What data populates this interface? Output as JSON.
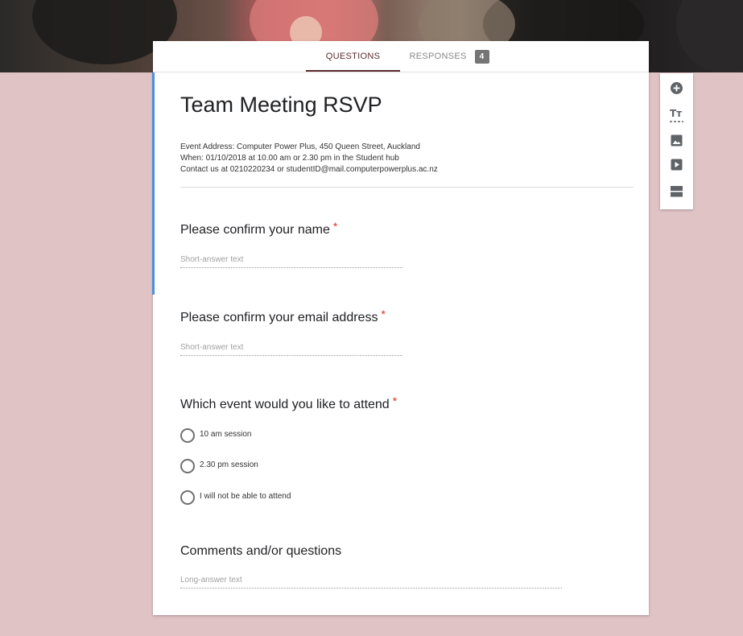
{
  "tabs": {
    "questions": "QUESTIONS",
    "responses": "RESPONSES",
    "responses_count": "4"
  },
  "form": {
    "title": "Team Meeting RSVP",
    "description_lines": [
      "Event Address: Computer Power Plus, 450 Queen Street, Auckland",
      "When: 01/10/2018 at 10.00 am or 2.30 pm in the Student hub",
      "Contact us at 0210220234 or studentID@mail.computerpowerplus.ac.nz"
    ]
  },
  "questions": [
    {
      "title": "Please confirm your name",
      "required_mark": "*",
      "placeholder": "Short-answer text"
    },
    {
      "title": "Please confirm your email address",
      "required_mark": "*",
      "placeholder": "Short-answer text"
    },
    {
      "title": "Which event would you like to attend",
      "required_mark": "*",
      "options": [
        "10 am session",
        "2.30 pm session",
        "I will not be able to attend"
      ]
    },
    {
      "title": "Comments and/or questions",
      "placeholder": "Long-answer text"
    }
  ],
  "toolbar": {
    "icons": [
      "add-question-icon",
      "add-title-icon",
      "add-image-icon",
      "add-video-icon",
      "add-section-icon"
    ]
  },
  "colors": {
    "background": "#dfc3c5",
    "accent": "#5b2c2e",
    "left_accent": "#4a90e2",
    "required": "#d93025"
  }
}
